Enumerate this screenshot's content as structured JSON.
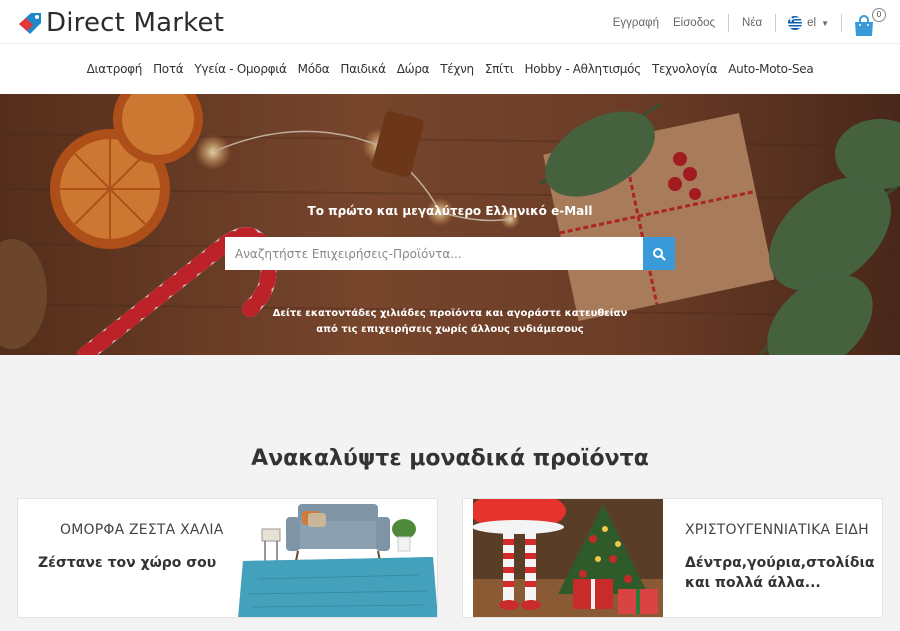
{
  "brand": {
    "name": "Direct Market"
  },
  "header": {
    "register": "Εγγραφή",
    "login": "Είσοδος",
    "news": "Νέα",
    "language": "el",
    "cart_count": "0"
  },
  "categories": [
    "Διατροφή",
    "Ποτά",
    "Υγεία - Ομορφιά",
    "Μόδα",
    "Παιδικά",
    "Δώρα",
    "Τέχνη",
    "Σπίτι",
    "Hobby - Αθλητισμός",
    "Τεχνολογία",
    "Auto-Moto-Sea"
  ],
  "hero": {
    "tagline": "Το πρώτο και μεγαλύτερο Ελληνικό e-Mall",
    "search_placeholder": "Αναζητήστε Επιχειρήσεις-Προϊόντα...",
    "sub_line1": "Δείτε εκατοντάδες χιλιάδες προϊόντα και αγοράστε κατευθείαν",
    "sub_line2": "από τις επιχειρήσεις χωρίς άλλους ενδιάμεσους"
  },
  "section": {
    "title": "Ανακαλύψτε μοναδικά προϊόντα"
  },
  "promos": [
    {
      "caption": "ΟΜΟΡΦΑ ΖΕΣΤΑ ΧΑΛΙΑ",
      "subtitle": "Ζέστανε τον χώρο σου"
    },
    {
      "caption": "ΧΡΙΣΤΟΥΓΕΝΝΙΑΤΙΚΑ ΕΙΔΗ",
      "subtitle_line1": "Δέντρα,γούρια,στολίδια",
      "subtitle_line2": "και πολλά άλλα..."
    }
  ],
  "colors": {
    "accent": "#3a9ad9",
    "logo_blue": "#1e88c9",
    "logo_red": "#e53935"
  },
  "icons": {
    "search": "search-icon",
    "cart": "shopping-bag-icon",
    "flag": "greek-flag-icon"
  }
}
